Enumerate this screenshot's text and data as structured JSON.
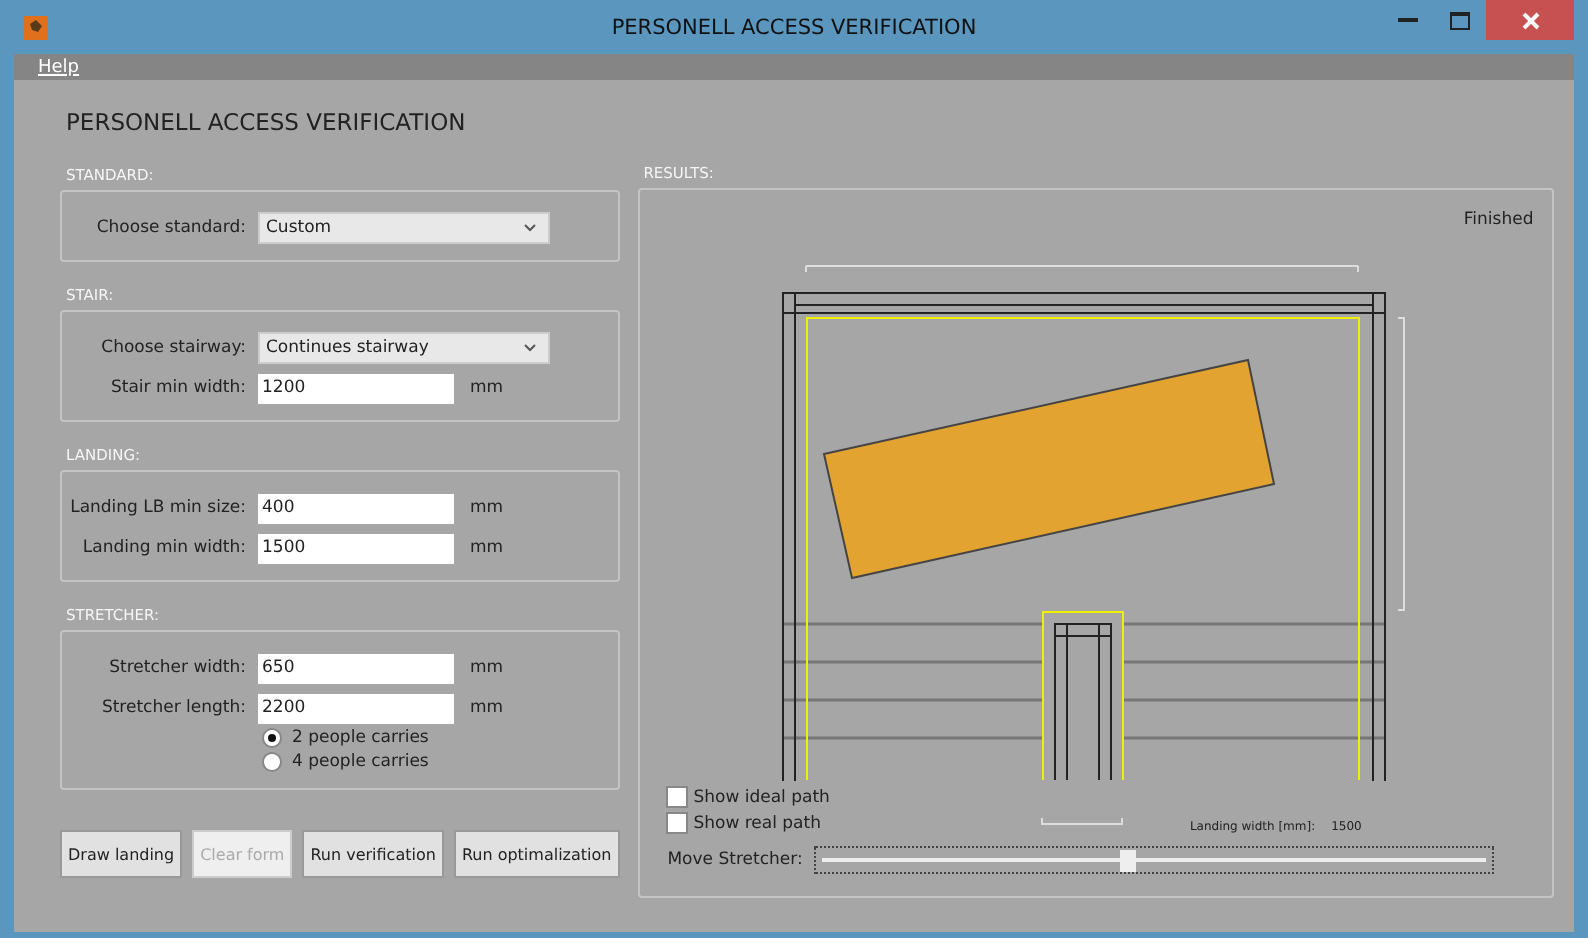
{
  "window": {
    "title": "PERSONELL ACCESS VERIFICATION"
  },
  "menu": [
    "Help"
  ],
  "heading": "PERSONELL ACCESS VERIFICATION",
  "sections": [
    {
      "title": "STANDARD:",
      "rows": [
        {
          "kind": "dropdown",
          "label": "Choose standard:",
          "value": "Custom"
        }
      ]
    },
    {
      "title": "STAIR:",
      "rows": [
        {
          "kind": "dropdown",
          "label": "Choose stairway:",
          "value": "Continues stairway"
        },
        {
          "kind": "input",
          "label": "Stair min width:",
          "value": "1200",
          "unit": "mm"
        }
      ]
    },
    {
      "title": "LANDING:",
      "rows": [
        {
          "kind": "input",
          "label": "Landing LB min size:",
          "value": "400",
          "unit": "mm"
        },
        {
          "kind": "input",
          "label": "Landing min width:",
          "value": "1500",
          "unit": "mm"
        }
      ]
    },
    {
      "title": "STRETCHER:",
      "rows": [
        {
          "kind": "input",
          "label": "Stretcher width:",
          "value": "650",
          "unit": "mm"
        },
        {
          "kind": "input",
          "label": "Stretcher length:",
          "value": "2200",
          "unit": "mm"
        },
        {
          "kind": "radio",
          "label": "2 people carries",
          "selected": true
        },
        {
          "kind": "radio",
          "label": "4 people carries",
          "selected": false
        }
      ]
    }
  ],
  "buttons": [
    {
      "label": "Draw landing",
      "disabled": false
    },
    {
      "label": "Clear form",
      "disabled": true
    },
    {
      "label": "Run verification",
      "disabled": false
    },
    {
      "label": "Run optimalization",
      "disabled": false
    }
  ],
  "results": {
    "title": "RESULTS:",
    "status": "Finished",
    "checkboxes": [
      {
        "label": "Show ideal path",
        "checked": false
      },
      {
        "label": "Show real path",
        "checked": false
      }
    ],
    "landing_width_label": "Landing width [mm]:",
    "landing_width_value": "1500",
    "slider": {
      "label": "Move Stretcher:",
      "level": 0.46
    }
  }
}
